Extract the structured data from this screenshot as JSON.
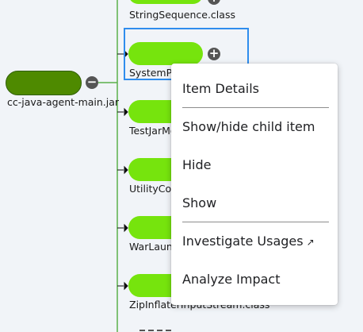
{
  "root": {
    "label": "cc-java-agent-main.jar",
    "toggle": "−"
  },
  "children": [
    {
      "label": "StringSequence.class"
    },
    {
      "label": "SystemPr",
      "toggle": "+"
    },
    {
      "label": "TestJarMo"
    },
    {
      "label": "UtilityCom"
    },
    {
      "label": "WarLaunc"
    },
    {
      "label": "ZipInflaterInputStream.class"
    }
  ],
  "context_menu": {
    "items": [
      "Item Details",
      "Show/hide child item",
      "Hide",
      "Show",
      "Investigate Usages",
      "Analyze Impact"
    ],
    "external_icon": "↗"
  },
  "colors": {
    "node": "#76e40d",
    "root_node": "#4e8a00",
    "selection": "#2f8ded",
    "edge": "#5ab04a"
  }
}
